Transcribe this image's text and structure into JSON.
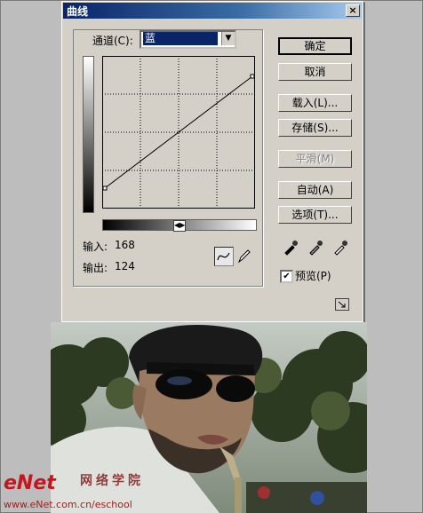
{
  "dialog": {
    "title": "曲线",
    "close_glyph": "×",
    "channel_label": "通道(C):",
    "channel_value": "蓝",
    "input_label": "输入:",
    "input_value": "168",
    "output_label": "输出:",
    "output_value": "124",
    "buttons": {
      "ok": "确定",
      "cancel": "取消",
      "load": "载入(L)...",
      "save": "存储(S)...",
      "smooth": "平滑(M)",
      "auto": "自动(A)",
      "options": "选项(T)..."
    },
    "preview_label": "预览(P)",
    "preview_checked": true,
    "curve": {
      "start": [
        0,
        0
      ],
      "end": [
        255,
        255
      ]
    },
    "icons": [
      "curve-tool-icon",
      "pencil-tool-icon",
      "black-eyedropper-icon",
      "gray-eyedropper-icon",
      "white-eyedropper-icon",
      "expand-icon"
    ]
  },
  "watermark": {
    "brand": "eNet",
    "tagline": "网络学院",
    "url": "www.eNet.com.cn/eschool"
  },
  "colors": {
    "title_start": "#0a246a",
    "title_end": "#a6caf0",
    "dialog_bg": "#d4d0c8",
    "watermark_red": "#c8141e"
  }
}
